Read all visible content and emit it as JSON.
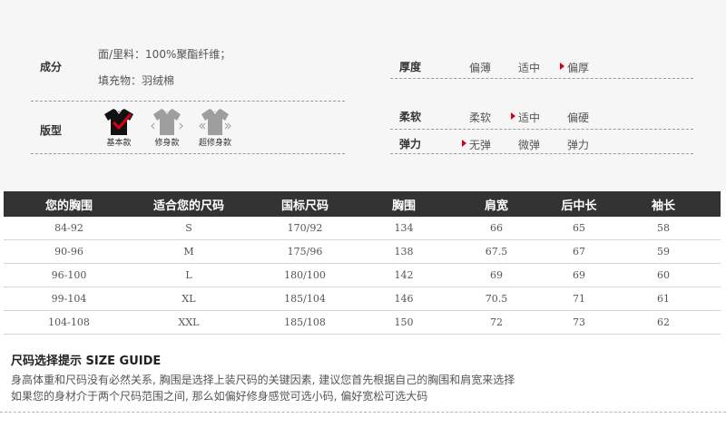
{
  "attributes": {
    "composition": {
      "label": "成分",
      "line1": "面/里料：100%聚酯纤维；",
      "line2": "填充物：羽绒棉"
    },
    "thickness": {
      "label": "厚度",
      "options": [
        "偏薄",
        "适中",
        "偏厚"
      ],
      "selected": "偏厚"
    },
    "fit": {
      "label": "版型",
      "options": [
        "基本款",
        "修身款",
        "超修身款"
      ],
      "selected": "基本款"
    },
    "softness": {
      "label": "柔软",
      "options": [
        "柔软",
        "适中",
        "偏硬"
      ],
      "selected": "适中"
    },
    "elasticity": {
      "label": "弹力",
      "options": [
        "无弹",
        "微弹",
        "弹力"
      ],
      "selected": "无弹"
    }
  },
  "size_table": {
    "headers": [
      "您的胸围",
      "适合您的尺码",
      "国标尺码",
      "胸围",
      "肩宽",
      "后中长",
      "袖长"
    ],
    "rows": [
      [
        "84-92",
        "S",
        "170/92",
        "134",
        "66",
        "65",
        "58"
      ],
      [
        "90-96",
        "M",
        "175/96",
        "138",
        "67.5",
        "67",
        "59"
      ],
      [
        "96-100",
        "L",
        "180/100",
        "142",
        "69",
        "69",
        "60"
      ],
      [
        "99-104",
        "XL",
        "185/104",
        "146",
        "70.5",
        "71",
        "61"
      ],
      [
        "104-108",
        "XXL",
        "185/108",
        "150",
        "72",
        "73",
        "62"
      ]
    ]
  },
  "size_guide": {
    "title": "尺码选择提示 SIZE GUIDE",
    "line1": "身高体重和尺码没有必然关系, 胸围是选择上装尺码的关键因素, 建议您首先根据自己的胸围和肩宽来选择",
    "line2": "如果您的身材介于两个尺码范围之间, 那么如偏好修身感觉可选小码, 偏好宽松可选大码"
  },
  "colors": {
    "selected_marker": "#d0021b",
    "header_bg": "#333333",
    "panel_bg": "#f6f6f6"
  }
}
